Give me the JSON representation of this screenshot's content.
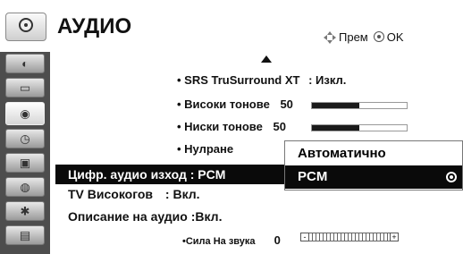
{
  "header": {
    "title": "АУДИО",
    "hint_move": "Прем",
    "hint_ok": "OK"
  },
  "sidebar": {
    "items": [
      {
        "icon": "satellite-icon"
      },
      {
        "icon": "picture-icon"
      },
      {
        "icon": "audio-icon",
        "active": true
      },
      {
        "icon": "clock-icon"
      },
      {
        "icon": "lock-icon"
      },
      {
        "icon": "option-icon"
      },
      {
        "icon": "bluetooth-icon"
      },
      {
        "icon": "media-icon"
      }
    ]
  },
  "menu": {
    "srs_label": "• SRS TruSurround XT",
    "srs_value": ": Изкл.",
    "treble_label": "• Високи тонове",
    "treble_value": "50",
    "bass_label": "• Ниски тонове",
    "bass_value": "50",
    "reset_label": "• Нулране",
    "digital_out_label": "Цифр. аудио изход : PCM",
    "tv_speaker_label": "TV Високогов",
    "tv_speaker_value": ": Вкл.",
    "audio_desc_label": "Описание на аудио :Вкл.",
    "volume_label": "•Сила На звука",
    "volume_value": "0"
  },
  "popup": {
    "options": [
      "Автоматично",
      "PCM"
    ],
    "selected": "PCM"
  },
  "levels": {
    "treble": 0.5,
    "bass": 0.5
  }
}
